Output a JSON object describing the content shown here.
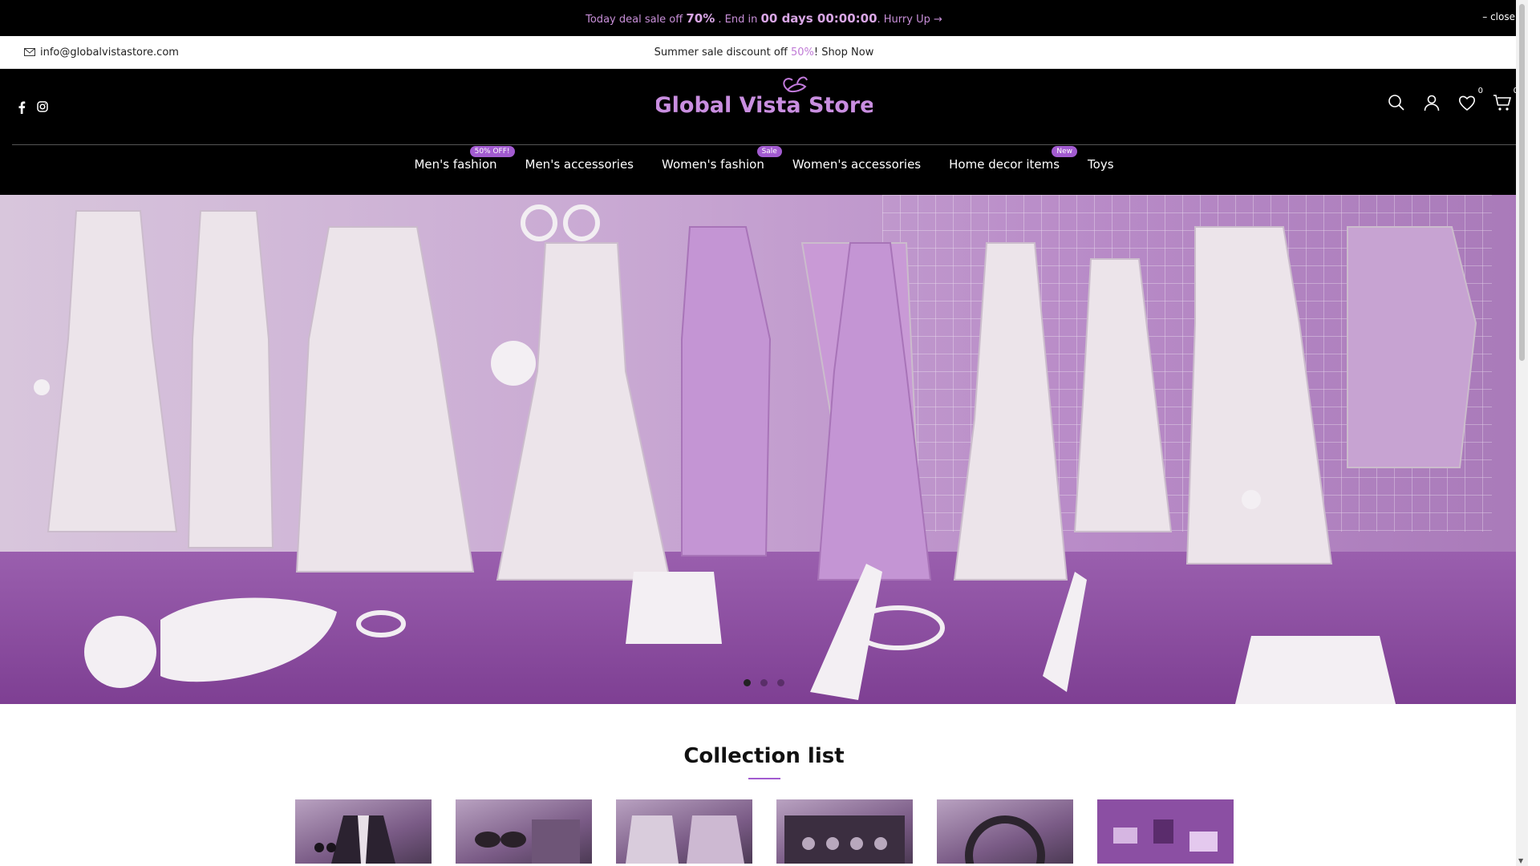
{
  "announcement": {
    "prefix": "Today deal sale off ",
    "discount": "70%",
    "middle": " . End in ",
    "countdown": "00 days 00:00:00",
    "suffix": ". Hurry Up →",
    "close_label": "– close"
  },
  "topbar": {
    "email": "info@globalvistastore.com",
    "promo_prefix": "Summer sale discount off ",
    "promo_percent": "50%",
    "promo_suffix": "! Shop Now"
  },
  "header": {
    "logo_text": "Global Vista Store",
    "wishlist_count": "0",
    "cart_count": "0"
  },
  "nav": [
    {
      "label": "Men's fashion",
      "badge": "50% OFF!"
    },
    {
      "label": "Men's accessories",
      "badge": ""
    },
    {
      "label": "Women's fashion",
      "badge": "Sale"
    },
    {
      "label": "Women's accessories",
      "badge": ""
    },
    {
      "label": "Home decor items",
      "badge": "New"
    },
    {
      "label": "Toys",
      "badge": ""
    }
  ],
  "collections": {
    "title": "Collection list"
  },
  "colors": {
    "accent": "#a25bd0",
    "announce_text": "#c88fd8"
  }
}
